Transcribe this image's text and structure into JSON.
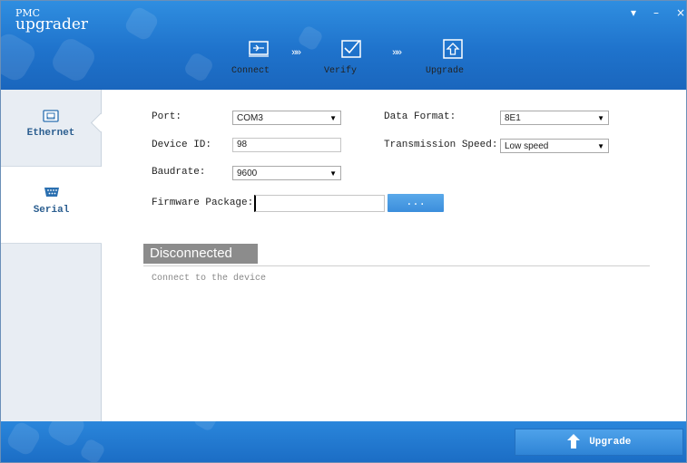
{
  "app": {
    "logo_small": "PMC",
    "logo_big": "upgrader"
  },
  "window_controls": {
    "menu": "▾",
    "minimize": "–",
    "close": "×"
  },
  "steps": [
    {
      "label": "Connect",
      "icon": "connect-icon"
    },
    {
      "label": "Verify",
      "icon": "verify-icon"
    },
    {
      "label": "Upgrade",
      "icon": "upgrade-arrow-icon"
    }
  ],
  "step_separator": "»»",
  "sidebar": {
    "items": [
      {
        "label": "Ethernet",
        "icon": "ethernet-icon",
        "active": false
      },
      {
        "label": "Serial",
        "icon": "serial-icon",
        "active": true
      }
    ]
  },
  "form": {
    "port_label": "Port:",
    "port_value": "COM3",
    "device_id_label": "Device ID:",
    "device_id_value": "98",
    "baudrate_label": "Baudrate:",
    "baudrate_value": "9600",
    "data_format_label": "Data Format:",
    "data_format_value": "8E1",
    "transmission_speed_label": "Transmission Speed:",
    "transmission_speed_value": "Low speed",
    "firmware_label": "Firmware Package:",
    "firmware_value": "",
    "browse_label": "..."
  },
  "status": {
    "title": "Disconnected",
    "message": "Connect to the device"
  },
  "footer": {
    "upgrade_label": "Upgrade"
  },
  "colors": {
    "header_blue": "#1f73cc",
    "button_blue": "#3b8edc",
    "status_gray": "#8c8c8c"
  }
}
